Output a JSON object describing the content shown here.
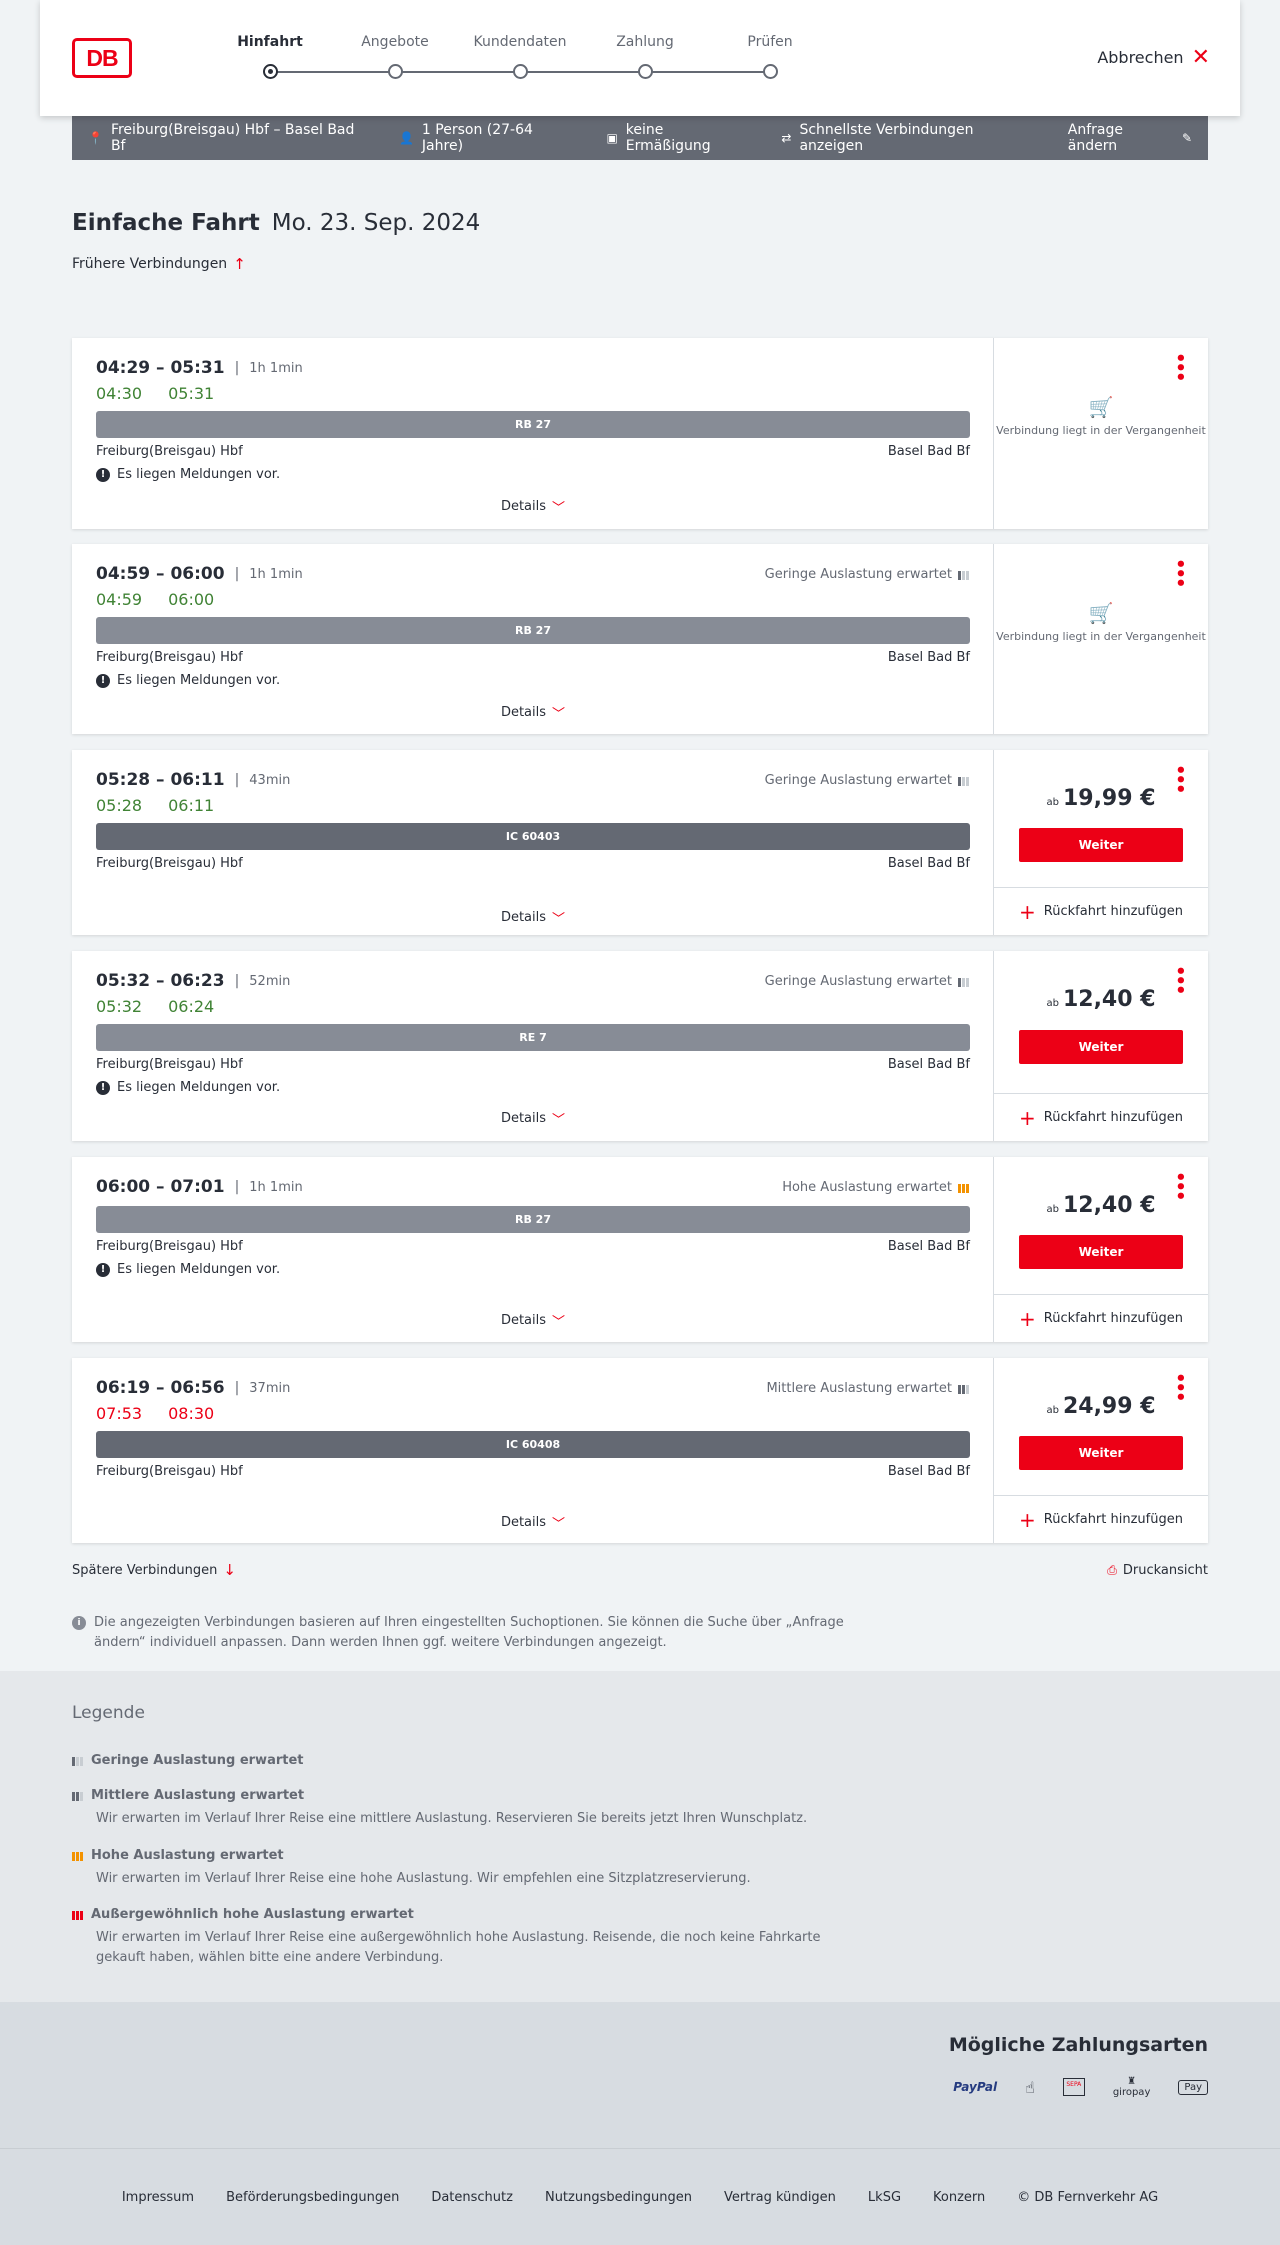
{
  "header": {
    "logo": "DB",
    "steps": [
      "Hinfahrt",
      "Angebote",
      "Kundendaten",
      "Zahlung",
      "Prüfen"
    ],
    "cancel_label": "Abbrechen"
  },
  "query": {
    "route": "Freiburg(Breisgau) Hbf – Basel Bad Bf",
    "persons": "1 Person (27-64 Jahre)",
    "discount": "keine Ermäßigung",
    "fastest": "Schnellste Verbindungen anzeigen",
    "change": "Anfrage ändern"
  },
  "page": {
    "title": "Einfache Fahrt",
    "date": "Mo. 23. Sep. 2024",
    "earlier": "Frühere Verbindungen",
    "later": "Spätere Verbindungen",
    "print": "Druckansicht",
    "note": "Die angezeigten Verbindungen basieren auf Ihren eingestellten Suchoptionen. Sie können die Suche über „Anfrage ändern“ individuell anpassen. Dann werden Ihnen ggf. weitere Verbindungen angezeigt."
  },
  "common": {
    "details": "Details",
    "weiter": "Weiter",
    "return": "Rückfahrt hinzufügen",
    "past": "Verbindung liegt in der Vergangenheit",
    "messages": "Es liegen Meldungen vor.",
    "ab": "ab"
  },
  "connections": [
    {
      "times": "04:29 – 05:31",
      "duration": "1h 1min",
      "load": "",
      "rt_dep": "04:30",
      "rt_arr": "05:31",
      "train": "RB 27",
      "from": "Freiburg(Breisgau) Hbf",
      "to": "Basel Bad Bf",
      "price": ""
    },
    {
      "times": "04:59 – 06:00",
      "duration": "1h 1min",
      "load": "Geringe Auslastung erwartet",
      "rt_dep": "04:59",
      "rt_arr": "06:00",
      "train": "RB 27",
      "from": "Freiburg(Breisgau) Hbf",
      "to": "Basel Bad Bf",
      "price": ""
    },
    {
      "times": "05:28 – 06:11",
      "duration": "43min",
      "load": "Geringe Auslastung erwartet",
      "rt_dep": "05:28",
      "rt_arr": "06:11",
      "train": "IC 60403",
      "from": "Freiburg(Breisgau) Hbf",
      "to": "Basel Bad Bf",
      "price": "19,99 €"
    },
    {
      "times": "05:32 – 06:23",
      "duration": "52min",
      "load": "Geringe Auslastung erwartet",
      "rt_dep": "05:32",
      "rt_arr": "06:24",
      "train": "RE 7",
      "from": "Freiburg(Breisgau) Hbf",
      "to": "Basel Bad Bf",
      "price": "12,40 €"
    },
    {
      "times": "06:00 – 07:01",
      "duration": "1h 1min",
      "load": "Hohe Auslastung erwartet",
      "rt_dep": "",
      "rt_arr": "",
      "train": "RB 27",
      "from": "Freiburg(Breisgau) Hbf",
      "to": "Basel Bad Bf",
      "price": "12,40 €"
    },
    {
      "times": "06:19 – 06:56",
      "duration": "37min",
      "load": "Mittlere Auslastung erwartet",
      "rt_dep": "07:53",
      "rt_arr": "08:30",
      "train": "IC 60408",
      "from": "Freiburg(Breisgau) Hbf",
      "to": "Basel Bad Bf",
      "price": "24,99 €"
    }
  ],
  "legend": {
    "title": "Legende",
    "items": [
      {
        "title": "Geringe Auslastung erwartet",
        "desc": ""
      },
      {
        "title": "Mittlere Auslastung erwartet",
        "desc": "Wir erwarten im Verlauf Ihrer Reise eine mittlere Auslastung. Reservieren Sie bereits jetzt Ihren Wunschplatz."
      },
      {
        "title": "Hohe Auslastung erwartet",
        "desc": "Wir erwarten im Verlauf Ihrer Reise eine hohe Auslastung. Wir empfehlen eine Sitzplatzreservierung."
      },
      {
        "title": "Außergewöhnlich hohe Auslastung erwartet",
        "desc": "Wir erwarten im Verlauf Ihrer Reise eine außergewöhnlich hohe Auslastung. Reisende, die noch keine Fahrkarte gekauft haben, wählen bitte eine andere Verbindung."
      }
    ]
  },
  "payment": {
    "title": "Mögliche Zahlungsarten",
    "paypal": "PayPal",
    "sepa": "SEPA",
    "giropay": "giropay",
    "applepay": "Pay"
  },
  "footer": [
    "Impressum",
    "Beförderungsbedingungen",
    "Datenschutz",
    "Nutzungsbedingungen",
    "Vertrag kündigen",
    "LkSG",
    "Konzern",
    "© DB Fernverkehr AG"
  ]
}
